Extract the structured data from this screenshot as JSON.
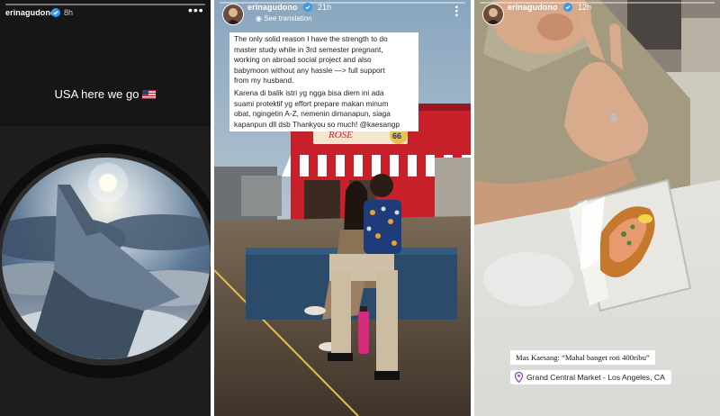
{
  "story1": {
    "username": "erinagudono",
    "time": "8h",
    "caption": "USA here we go",
    "flag": "us-flag"
  },
  "story2": {
    "username": "erinagudono",
    "time": "21h",
    "see_translation": "See translation",
    "paragraph1": [
      "The only solid reason I have the strength to do",
      "master study while in 3rd semester pregnant,",
      "working on abroad social project and also",
      "babymoon without any hassle —> full support",
      "from my husband."
    ],
    "paragraph2": [
      "Karena di balik istri yg ngga bisa diem ini ada",
      "suami protektif yg effort prepare makan minum",
      "obat, ngingetin A-Z, nemenin dimanapun, siaga",
      "kapanpun dll dsb Thankyou so much! @kaesangp"
    ],
    "sign_text": "ROSE",
    "sign_number": "66"
  },
  "story3": {
    "username": "erinagudono",
    "time": "12h",
    "tag_text": "Mas Kaesang: “Mahal banget roti 400ribu”",
    "location": "Grand Central Market - Los Angeles, CA"
  },
  "colors": {
    "story_bg_dark": "#171717",
    "accent_red": "#c8202a",
    "verified_blue": "#3897f0"
  }
}
